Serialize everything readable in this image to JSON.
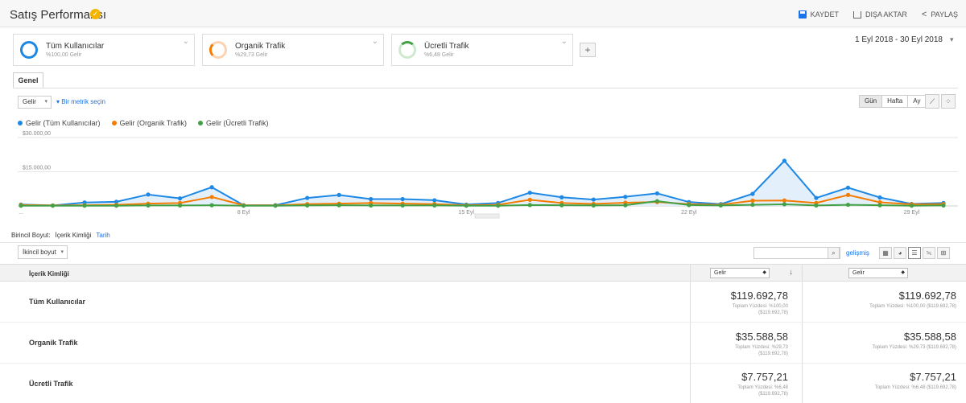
{
  "header": {
    "title": "Satış Performansı",
    "actions": {
      "save": "KAYDET",
      "export": "DIŞA AKTAR",
      "share": "PAYLAŞ"
    }
  },
  "segments": [
    {
      "name": "Tüm Kullanıcılar",
      "sub": "%100,00 Gelir",
      "color": "#1e88e5"
    },
    {
      "name": "Organik Trafik",
      "sub": "%29,73 Gelir",
      "color": "#f57c00"
    },
    {
      "name": "Ücretli Trafik",
      "sub": "%6,48 Gelir",
      "color": "#43a047"
    }
  ],
  "add_segment": "+",
  "date_range": "1 Eyl 2018 - 30 Eyl 2018",
  "tab": "Genel",
  "controls": {
    "metric": "Gelir",
    "vs_metric": "Bir metrik seçin",
    "grain": [
      "Gün",
      "Hafta",
      "Ay"
    ],
    "grain_active": "Gün"
  },
  "chart_data": {
    "type": "line",
    "x": [
      "1 Eyl",
      "2 Eyl",
      "3 Eyl",
      "4 Eyl",
      "5 Eyl",
      "6 Eyl",
      "7 Eyl",
      "8 Eyl",
      "9 Eyl",
      "10 Eyl",
      "11 Eyl",
      "12 Eyl",
      "13 Eyl",
      "14 Eyl",
      "15 Eyl",
      "16 Eyl",
      "17 Eyl",
      "18 Eyl",
      "19 Eyl",
      "20 Eyl",
      "21 Eyl",
      "22 Eyl",
      "23 Eyl",
      "24 Eyl",
      "25 Eyl",
      "26 Eyl",
      "27 Eyl",
      "28 Eyl",
      "29 Eyl",
      "30 Eyl"
    ],
    "xticks": [
      "...",
      "8 Eyl",
      "15 Eyl",
      "22 Eyl",
      "29 Eyl"
    ],
    "yticks": [
      "$30.000,00",
      "$15.000,00"
    ],
    "ylim": [
      0,
      30000
    ],
    "series": [
      {
        "name": "Gelir (Tüm Kullanıcılar)",
        "color": "#1e88e5",
        "values": [
          600,
          200,
          1500,
          1800,
          5000,
          3300,
          8200,
          300,
          300,
          3500,
          4800,
          3000,
          3000,
          2500,
          600,
          1300,
          5800,
          3800,
          2800,
          4000,
          5500,
          1700,
          800,
          5300,
          19800,
          3500,
          8000,
          3700,
          900,
          1300
        ]
      },
      {
        "name": "Gelir (Organik Trafik)",
        "color": "#f57c00",
        "values": [
          400,
          200,
          300,
          500,
          1000,
          1300,
          3900,
          300,
          200,
          800,
          1000,
          1300,
          1000,
          800,
          300,
          500,
          2700,
          1300,
          900,
          1400,
          1700,
          800,
          500,
          2300,
          2400,
          1300,
          4800,
          1600,
          700,
          800
        ]
      },
      {
        "name": "Gelir (Ücretli Trafik)",
        "color": "#43a047",
        "values": [
          100,
          100,
          100,
          100,
          200,
          200,
          300,
          100,
          100,
          200,
          300,
          200,
          200,
          200,
          100,
          100,
          400,
          300,
          200,
          300,
          2100,
          400,
          200,
          500,
          700,
          200,
          500,
          300,
          100,
          200
        ]
      }
    ],
    "grid": true
  },
  "table": {
    "dimension_label": "Birincil Boyut:",
    "dimensions": [
      "İçerik Kimliği",
      "Tarih"
    ],
    "secondary_dimension": "İkincil boyut",
    "advanced": "gelişmiş",
    "column_header": "İçerik Kimliği",
    "metric_col1": "Gelir",
    "metric_col2": "Gelir",
    "rows": [
      {
        "label": "Tüm Kullanıcılar",
        "v1": "$119.692,78",
        "s1a": "Toplam Yüzdesi: %100,00",
        "s1b": "($119.692,78)",
        "v2": "$119.692,78",
        "s2a": "Toplam Yüzdesi: %100,00 ($119.692,78)"
      },
      {
        "label": "Organik Trafik",
        "v1": "$35.588,58",
        "s1a": "Toplam Yüzdesi: %29,73",
        "s1b": "($119.692,78)",
        "v2": "$35.588,58",
        "s2a": "Toplam Yüzdesi: %29,73 ($119.692,78)"
      },
      {
        "label": "Ücretli Trafik",
        "v1": "$7.757,21",
        "s1a": "Toplam Yüzdesi: %6,48",
        "s1b": "($119.692,78)",
        "v2": "$7.757,21",
        "s2a": "Toplam Yüzdesi: %6,48 ($119.692,78)"
      }
    ]
  }
}
